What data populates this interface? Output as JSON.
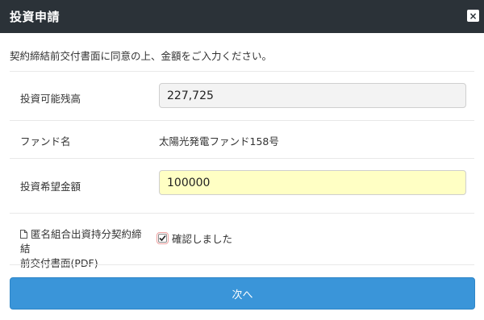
{
  "header": {
    "title": "投資申請",
    "close_label": "×"
  },
  "intro_text": "契約締結前交付書面に同意の上、金額をご入力ください。",
  "rows": {
    "balance": {
      "label": "投資可能残高",
      "value": "227,725"
    },
    "fund": {
      "label": "ファンド名",
      "value": "太陽光発電ファンド158号"
    },
    "amount": {
      "label": "投資希望金額",
      "value": "100000"
    },
    "document": {
      "label_line1": "匿名組合出資持分契約締結",
      "label_line2": "前交付書面(PDF)",
      "icon": "document-icon",
      "checkbox_label": "確認しました",
      "checked": true
    }
  },
  "buttons": {
    "next_label": "次へ"
  },
  "colors": {
    "header_bg": "#2b3238",
    "primary_button": "#3a95d9",
    "input_highlight": "#ffffc4",
    "readonly_bg": "#f3f3f3"
  }
}
